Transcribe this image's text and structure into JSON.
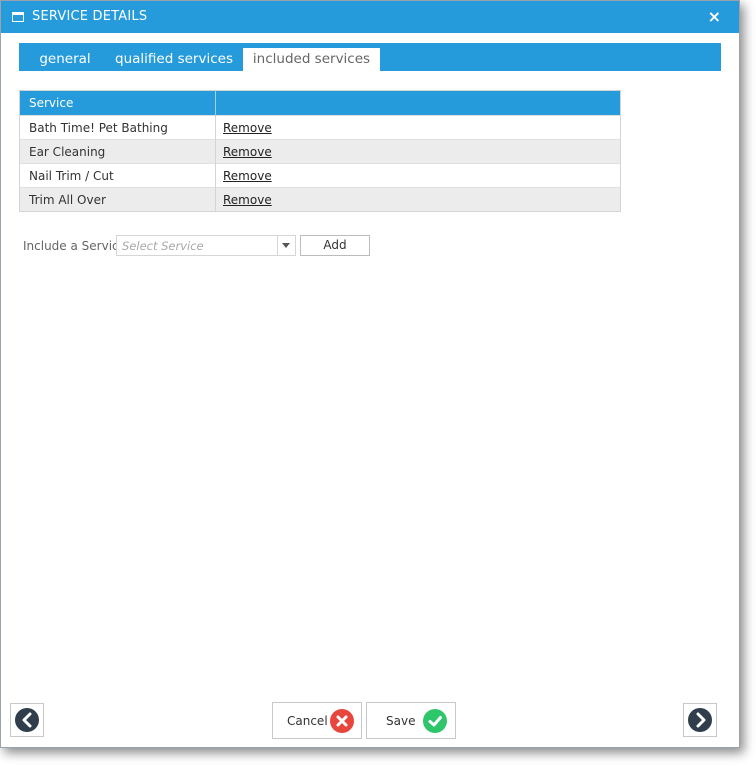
{
  "window": {
    "title": "SERVICE DETAILS",
    "icon": "window-icon",
    "close_label": "×"
  },
  "tabs": [
    {
      "label": "general",
      "active": false
    },
    {
      "label": "qualified services",
      "active": false
    },
    {
      "label": "included services",
      "active": true
    }
  ],
  "table": {
    "columns": [
      "Service",
      ""
    ],
    "rows": [
      {
        "service": "Bath Time! Pet Bathing",
        "action": "Remove"
      },
      {
        "service": "Ear Cleaning",
        "action": "Remove"
      },
      {
        "service": "Nail Trim / Cut",
        "action": "Remove"
      },
      {
        "service": "Trim All Over",
        "action": "Remove"
      }
    ]
  },
  "include": {
    "label": "Include a Service",
    "select_placeholder": "Select Service",
    "add_label": "Add"
  },
  "footer": {
    "cancel_label": "Cancel",
    "save_label": "Save",
    "prev_icon": "chevron-left-icon",
    "next_icon": "chevron-right-icon"
  },
  "colors": {
    "accent": "#259bdc",
    "cancel": "#e8463c",
    "save": "#2ec56b",
    "nav": "#2f3d4c"
  }
}
